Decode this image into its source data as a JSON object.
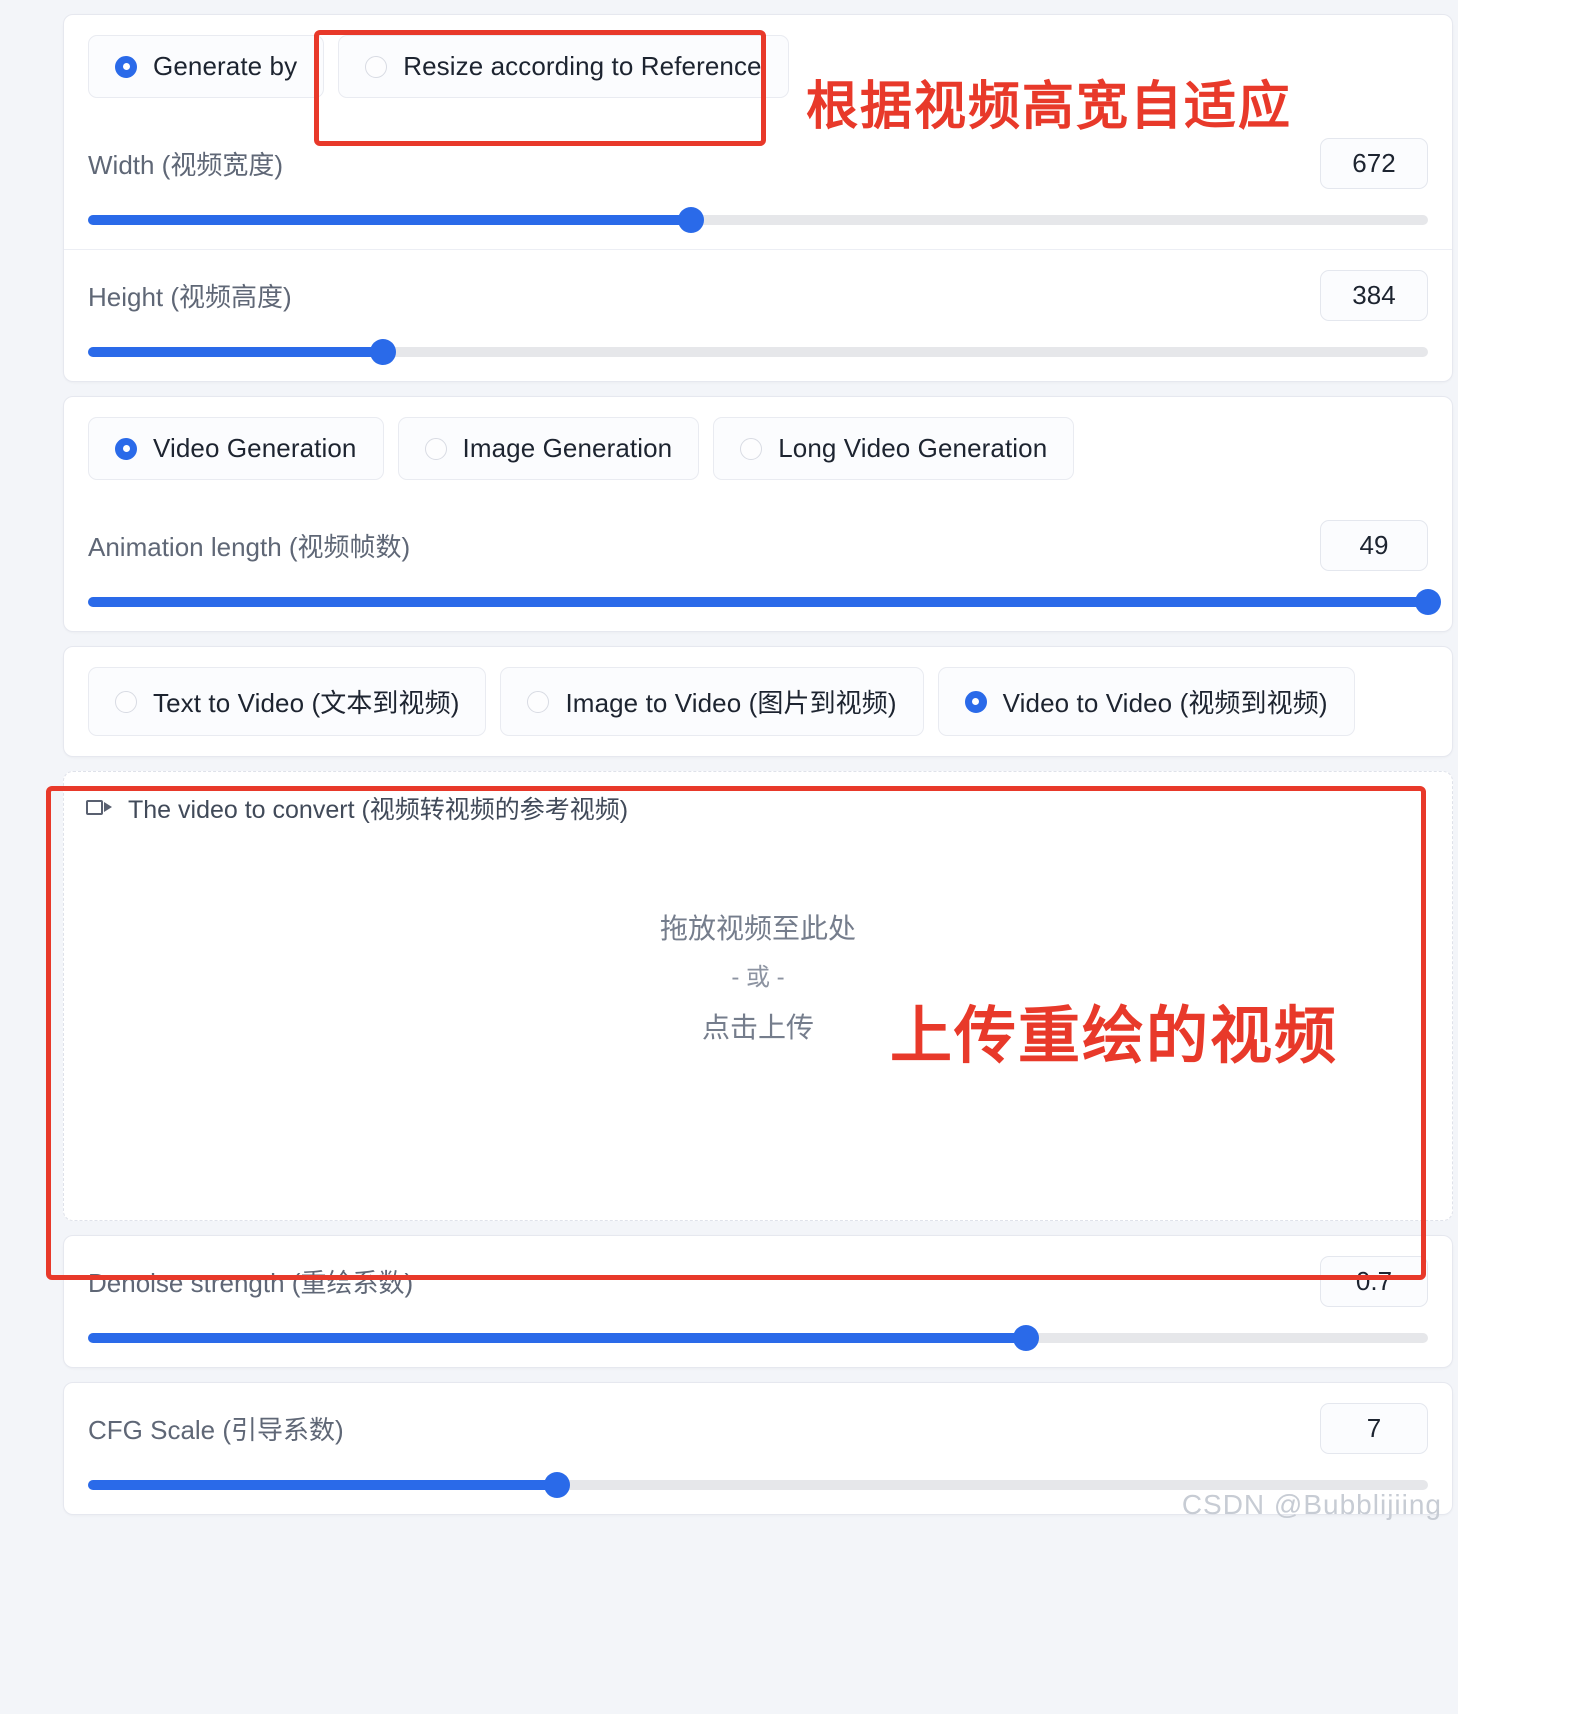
{
  "resize_group": {
    "options": [
      {
        "label": "Generate by",
        "selected": true
      },
      {
        "label": "Resize according to Reference",
        "selected": false
      }
    ],
    "annotation": "根据视频高宽自适应"
  },
  "dimensions": {
    "width": {
      "label": "Width (视频宽度)",
      "value": "672",
      "percent": 45
    },
    "height": {
      "label": "Height (视频高度)",
      "value": "384",
      "percent": 22
    }
  },
  "mode_group": {
    "options": [
      {
        "label": "Video Generation",
        "selected": true
      },
      {
        "label": "Image Generation",
        "selected": false
      },
      {
        "label": "Long Video Generation",
        "selected": false
      }
    ]
  },
  "animation": {
    "label": "Animation length (视频帧数)",
    "value": "49",
    "percent": 100
  },
  "task_group": {
    "options": [
      {
        "label": "Text to Video (文本到视频)",
        "selected": false
      },
      {
        "label": "Image to Video (图片到视频)",
        "selected": false
      },
      {
        "label": "Video to Video (视频到视频)",
        "selected": true
      }
    ]
  },
  "upload": {
    "tag_label": "The video to convert (视频转视频的参考视频)",
    "tag_icon": "video-camera-icon",
    "drop_main": "拖放视频至此处",
    "drop_or": "- 或 -",
    "drop_click": "点击上传",
    "annotation": "上传重绘的视频"
  },
  "denoise": {
    "label": "Denoise strength (重绘系数)",
    "value": "0.7",
    "percent": 70
  },
  "cfg": {
    "label": "CFG Scale (引导系数)",
    "value": "7",
    "percent": 35
  },
  "watermark": "CSDN @Bubblijiing",
  "colors": {
    "accent": "#2a6ae9",
    "annotation_red": "#e8392a",
    "page_bg": "#f3f5f9"
  }
}
